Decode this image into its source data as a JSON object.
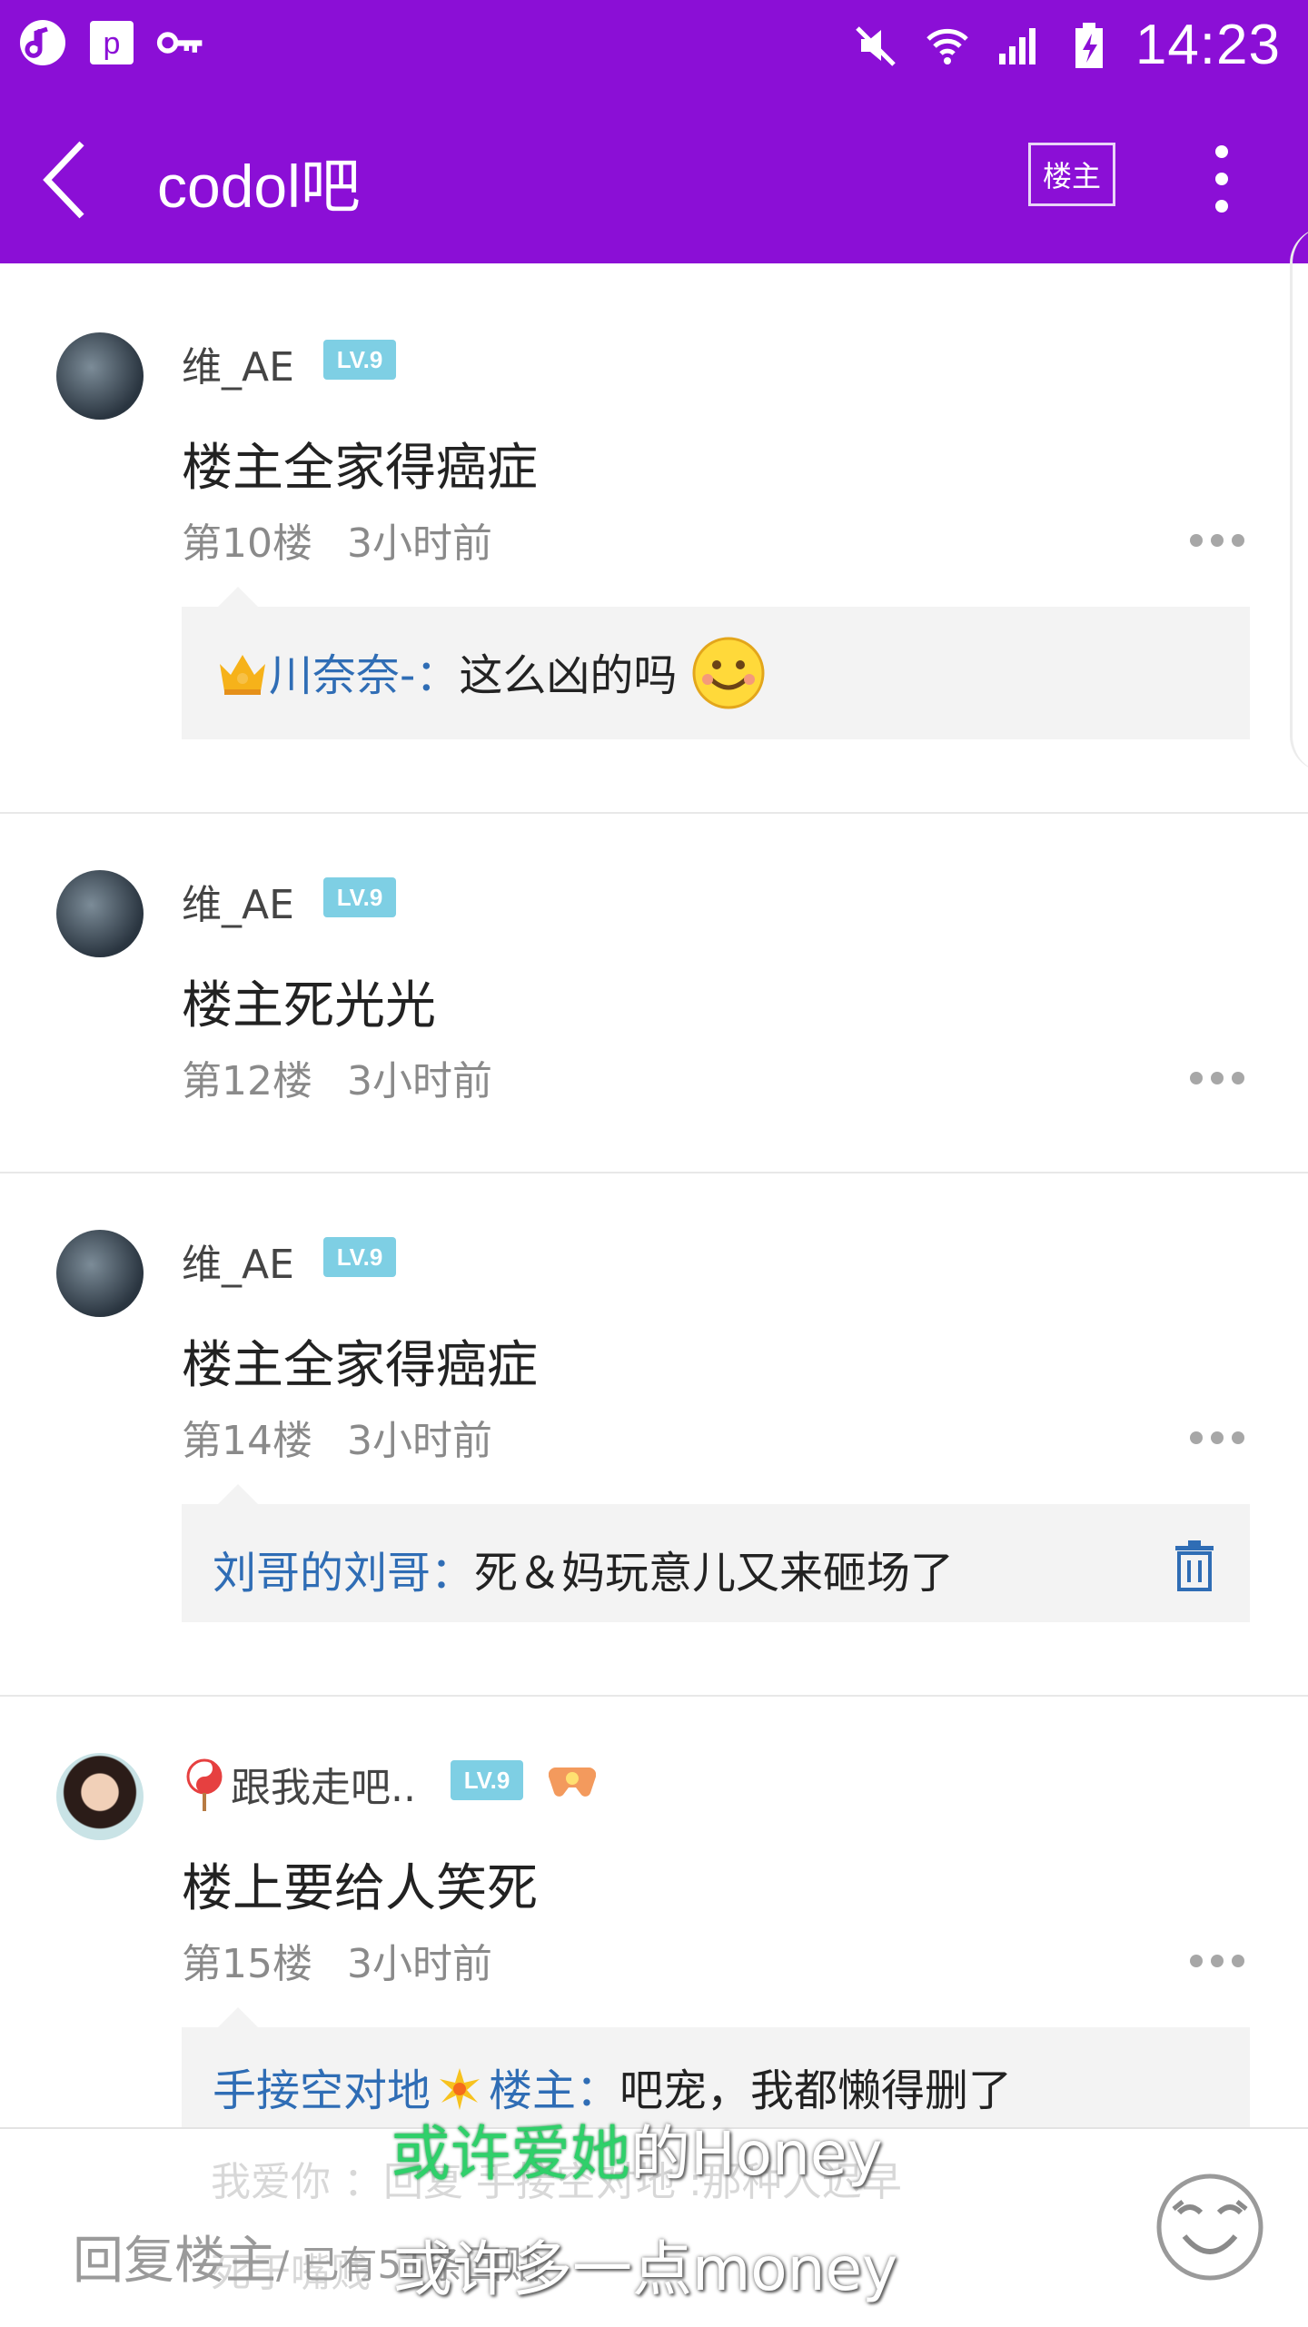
{
  "status_bar": {
    "time": "14:23"
  },
  "nav": {
    "title": "codol吧",
    "owner_button": "楼主"
  },
  "posts": [
    {
      "user": "维_AE",
      "level": "LV.9",
      "content": "楼主全家得癌症",
      "floor": "第10楼",
      "time": "3小时前",
      "reply": {
        "name": "川奈奈-",
        "sep": "：",
        "text": "这么凶的吗"
      }
    },
    {
      "user": "维_AE",
      "level": "LV.9",
      "content": "楼主死光光",
      "floor": "第12楼",
      "time": "3小时前"
    },
    {
      "user": "维_AE",
      "level": "LV.9",
      "content": "楼主全家得癌症",
      "floor": "第14楼",
      "time": "3小时前",
      "reply": {
        "name": "刘哥的刘哥",
        "sep": "：",
        "text": "死＆妈玩意儿又来砸场了"
      }
    },
    {
      "user": "跟我走吧..",
      "level": "LV.9",
      "content": "楼上要给人笑死",
      "floor": "第15楼",
      "time": "3小时前",
      "reply": {
        "name": "手接空对地",
        "name2": "楼主",
        "sep": "：",
        "text": "吧宠，我都懒得删了"
      }
    }
  ],
  "ghost_text": {
    "line1": "我爱你   ：回复 手接空对地   :那种人迟早",
    "line2": "死于嘴贱"
  },
  "bottom_bar": {
    "placeholder": "回复楼主",
    "reply_count": "/ 已有51条回贴"
  },
  "lyrics": {
    "line1_green": "或许爱她",
    "line1_rest": "的Honey",
    "line2": "或许多一点money"
  },
  "colors": {
    "brand": "#8b0fd6",
    "reply_name": "#2f6db5",
    "level_badge": "#7ecfe4"
  }
}
